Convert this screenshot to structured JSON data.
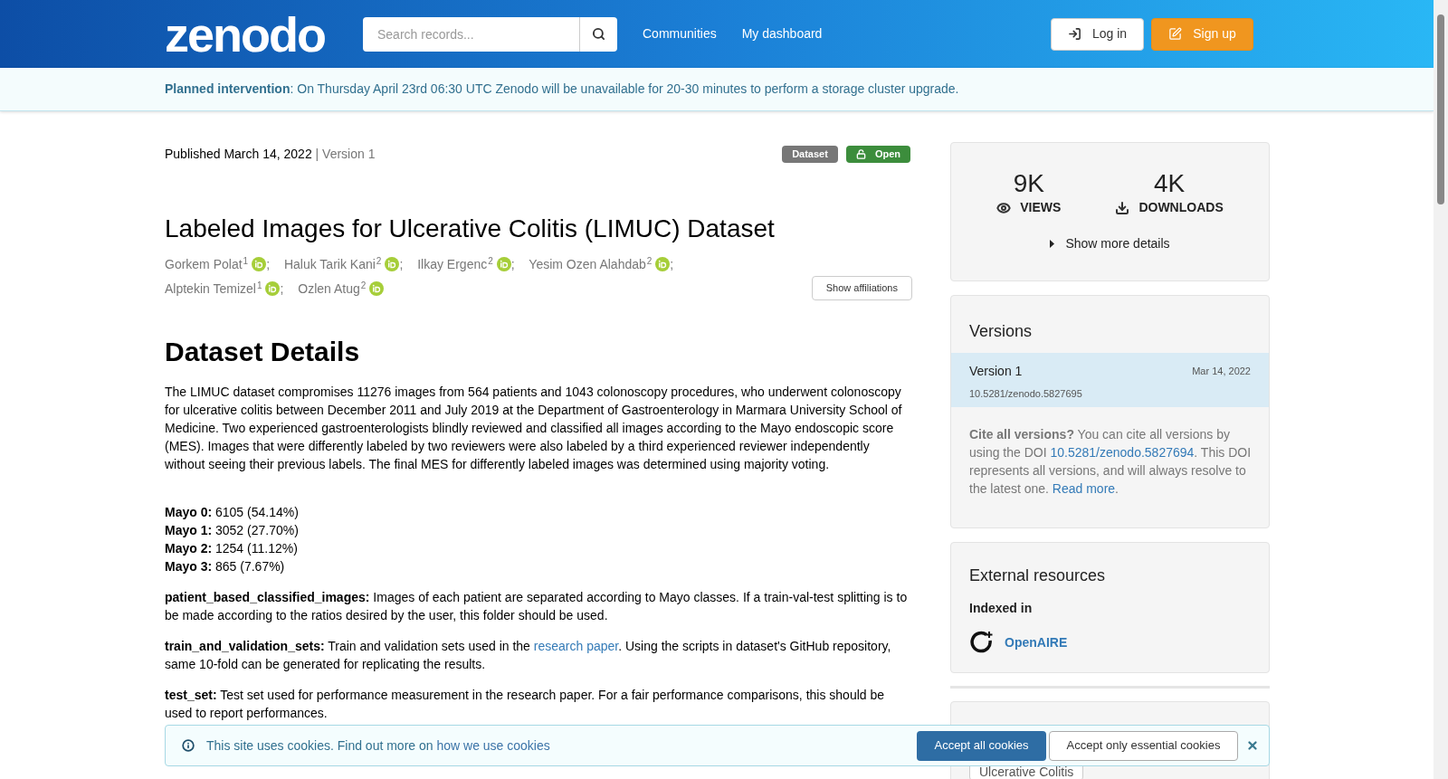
{
  "header": {
    "logo": "zenodo",
    "search": {
      "placeholder": "Search records..."
    },
    "nav": [
      "Communities",
      "My dashboard"
    ],
    "login": "Log in",
    "signup": "Sign up"
  },
  "announcement": {
    "label": "Planned intervention",
    "text": ": On Thursday April 23rd 06:30 UTC Zenodo will be unavailable for 20-30 minutes to perform a storage cluster upgrade."
  },
  "record": {
    "published": "Published March 14, 2022",
    "version": "| Version 1",
    "badges": [
      {
        "kind": "type",
        "label": "Dataset"
      },
      {
        "kind": "access",
        "label": "Open"
      }
    ],
    "title": "Labeled Images for Ulcerative Colitis (LIMUC) Dataset",
    "authors": [
      {
        "name": "Gorkem Polat",
        "affiliation": "1",
        "sep": ";"
      },
      {
        "name": "Haluk Tarik Kani",
        "affiliation": "2",
        "sep": ";"
      },
      {
        "name": "Ilkay Ergenc",
        "affiliation": "2",
        "sep": ";"
      },
      {
        "name": "Yesim Ozen Alahdab",
        "affiliation": "2",
        "sep": ";"
      },
      {
        "name": "Alptekin Temizel",
        "affiliation": "1",
        "sep": ";"
      },
      {
        "name": "Ozlen Atug",
        "affiliation": "2"
      }
    ],
    "show_affiliations": "Show affiliations",
    "section_heading": "Dataset Details",
    "description": "The LIMUC dataset compromises 11276 images from 564 patients and 1043 colonoscopy procedures, who underwent colonoscopy for ulcerative colitis between December 2011 and July 2019 at the Department of Gastroenterology in Marmara University School of Medicine. Two experienced gastroenterologists blindly reviewed and classified all images according to the Mayo endoscopic score (MES). Images that were differently labeled by two reviewers were also labeled by a third experienced reviewer independently without seeing their previous labels. The final MES for differently labeled images was determined using majority voting.",
    "mayo": [
      {
        "term": "Mayo 0:",
        "value": "6105 (54.14%)"
      },
      {
        "term": "Mayo 1:",
        "value": "3052 (27.70%)"
      },
      {
        "term": "Mayo 2:",
        "value": "1254 (11.12%)"
      },
      {
        "term": "Mayo 3:",
        "value": "865 (7.67%)"
      }
    ],
    "folders": [
      {
        "term": "patient_based_classified_images:",
        "parts": [
          {
            "kind": "text",
            "text": " Images of each patient are separated according to Mayo classes. If a train-val-test splitting is to be made according to the ratios desired by the user, this folder should be used."
          }
        ]
      },
      {
        "term": "train_and_validation_sets:",
        "parts": [
          {
            "kind": "text",
            "text": " Train and validation sets used in the "
          },
          {
            "kind": "link",
            "text": "research paper"
          },
          {
            "kind": "text",
            "text": ". Using the scripts in dataset's GitHub repository, same 10-fold can be generated for replicating the results."
          }
        ]
      },
      {
        "term": "test_set:",
        "parts": [
          {
            "kind": "text",
            "text": " Test set used for performance measurement in the research paper. For a fair performance comparisons, this should be used to report performances."
          }
        ]
      }
    ]
  },
  "sidebar": {
    "stats": [
      {
        "kind": "views",
        "value": "9K",
        "label": "VIEWS"
      },
      {
        "kind": "downloads",
        "value": "4K",
        "label": "DOWNLOADS"
      }
    ],
    "show_more": "Show more details",
    "versions": {
      "title": "Versions",
      "items": [
        {
          "label": "Version 1",
          "date": "Mar 14, 2022",
          "doi": "10.5281/zenodo.5827695",
          "selected": true
        }
      ],
      "cite_label": "Cite all versions?",
      "cite_text": " You can cite all versions by using the DOI ",
      "cite_doi": "10.5281/zenodo.5827694",
      "cite_text2": ". This DOI represents all versions, and will always resolve to the latest one. ",
      "read_more": "Read more",
      "cite_end": "."
    },
    "external": {
      "title": "External resources",
      "subtitle": "Indexed in",
      "link": "OpenAIRE"
    },
    "keyword": "Ulcerative Colitis"
  },
  "cookies": {
    "text": "This site uses cookies. Find out more on ",
    "link": "how we use cookies",
    "accept_all": "Accept all cookies",
    "accept_essential": "Accept only essential cookies"
  }
}
